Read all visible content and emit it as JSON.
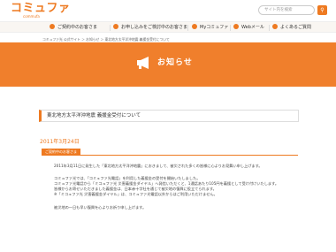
{
  "header": {
    "logo_text": "コミュファ",
    "logo_sub": "commufa",
    "search_placeholder": "サイト内を検索",
    "search_icon": "search-icon"
  },
  "nav": {
    "items": [
      {
        "label": "ご契約中のお客さま",
        "icon": "user-icon"
      },
      {
        "label": "お申し込みをご検討中のお客さま",
        "icon": "home-icon"
      },
      {
        "label": "Myコミュファ",
        "icon": "heart-icon"
      },
      {
        "label": "Webメール",
        "icon": "mail-icon"
      },
      {
        "label": "よくあるご質問",
        "icon": "question-icon"
      }
    ]
  },
  "breadcrumb": "コミュファ光 公式サイト ＞ お知らせ ＞ 東北地方太平洋沖地震 義援金受付について",
  "hero": {
    "title": "お知らせ",
    "icon": "megaphone-icon"
  },
  "article": {
    "title": "東北地方太平洋沖地震 義援金受付について",
    "date": "2011年3月24日",
    "tag": "ご契約中のお客さま",
    "paragraphs": [
      "2011年3月11日に発生した「東北地方太平洋沖地震」におきまして、被災された多くの皆様に心よりお見舞い申し上げます。",
      "コミュファ光では、「コミュファ光電話」を利用した義援金の受付を開始いたしました。",
      "コミュファ光電話から「ミコュファ光 災害義援金ダイヤル」へ発信いただくと、1通話あたり105円を義援として受け付けいたします。",
      "皆様からお寄せいただきました義援金は、日本赤十字社を通じて被災地の復興に役立てられます。",
      "※「ミコュファ光 災害義援金ダイヤル」は、コミュファ光電話以外からはご利用いただけません。",
      "被災地の一日も早い復興を心よりお祈り申し上げます。"
    ]
  }
}
